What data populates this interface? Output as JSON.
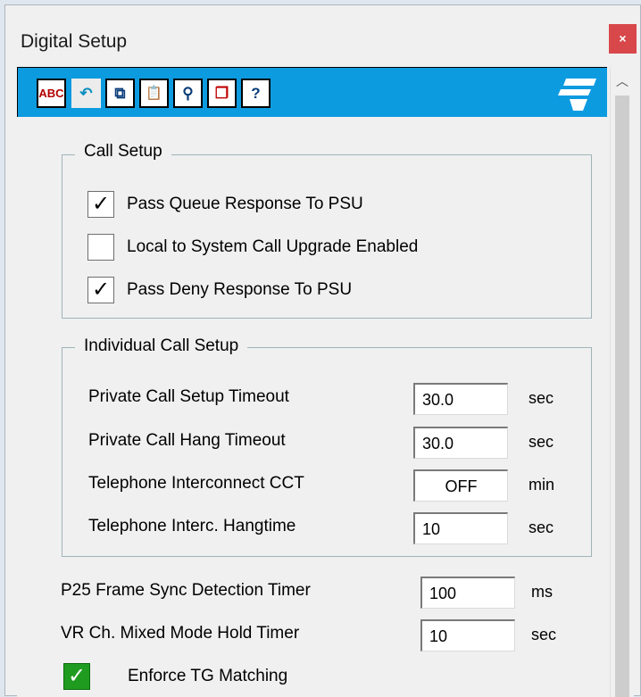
{
  "window": {
    "title": "Digital Setup",
    "close_glyph": "×"
  },
  "toolbar": {
    "buttons": [
      {
        "name": "spell-check-icon",
        "glyph": "ABC"
      },
      {
        "name": "undo-icon",
        "glyph": "↶"
      },
      {
        "name": "copy-icon",
        "glyph": "⧉"
      },
      {
        "name": "paste-icon",
        "glyph": "📋"
      },
      {
        "name": "find-icon",
        "glyph": "⚲"
      },
      {
        "name": "window-icon",
        "glyph": "❐"
      },
      {
        "name": "help-book-icon",
        "glyph": "?"
      }
    ],
    "logo": "brand-logo-icon"
  },
  "call_setup": {
    "label": "Call Setup",
    "items": [
      {
        "label": "Pass Queue Response To PSU",
        "checked": true
      },
      {
        "label": "Local to System Call Upgrade Enabled",
        "checked": false
      },
      {
        "label": "Pass Deny Response To PSU",
        "checked": true
      }
    ]
  },
  "individual_call_setup": {
    "label": "Individual Call Setup",
    "fields": [
      {
        "label": "Private Call Setup Timeout",
        "value": "30.0",
        "unit": "sec"
      },
      {
        "label": "Private Call Hang Timeout",
        "value": "30.0",
        "unit": "sec"
      },
      {
        "label": "Telephone Interconnect CCT",
        "value": "OFF",
        "unit": "min"
      },
      {
        "label": "Telephone Interc. Hangtime",
        "value": "10",
        "unit": "sec"
      }
    ]
  },
  "timers": [
    {
      "label": "P25 Frame Sync Detection Timer",
      "value": "100",
      "unit": "ms"
    },
    {
      "label": "VR Ch. Mixed Mode Hold Timer",
      "value": "10",
      "unit": "sec"
    }
  ],
  "enforce_tg": {
    "label": "Enforce TG Matching",
    "checked": true
  },
  "check_glyph": "✓",
  "colors": {
    "toolbar": "#0d9be0",
    "close": "#d8474a",
    "checked_green": "#1f9b1f"
  }
}
